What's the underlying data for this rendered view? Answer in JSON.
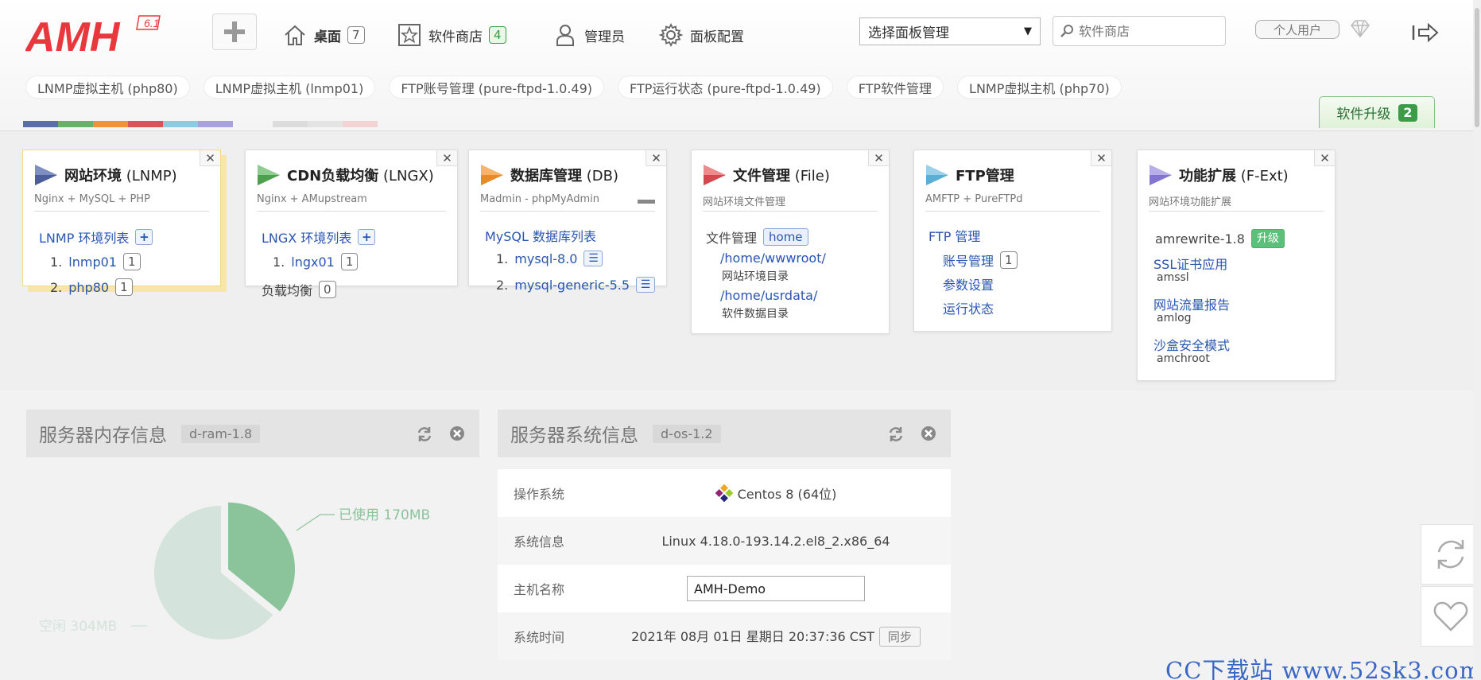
{
  "logo": {
    "text": "AMH",
    "version": "6.1"
  },
  "nav": {
    "desktop": {
      "label": "桌面",
      "count": "7"
    },
    "store": {
      "label": "软件商店",
      "count": "4"
    },
    "admin": {
      "label": "管理员"
    },
    "config": {
      "label": "面板配置"
    }
  },
  "panel_select": {
    "value": "选择面板管理"
  },
  "search": {
    "placeholder": "软件商店"
  },
  "user_button": "个人用户",
  "quick_tabs": [
    "LNMP虚拟主机 (php80)",
    "LNMP虚拟主机 (lnmp01)",
    "FTP账号管理 (pure-ftpd-1.0.49)",
    "FTP运行状态 (pure-ftpd-1.0.49)",
    "FTP软件管理",
    "LNMP虚拟主机 (php70)"
  ],
  "upgrade": {
    "label": "软件升级",
    "count": "2"
  },
  "colors": {
    "accent_green": "#3c9b47",
    "link_blue": "#2a56b0",
    "pie_used": "#8bc49b",
    "pie_free": "#d4e3dc"
  },
  "modules": {
    "lnmp": {
      "title_bold": "网站环境",
      "title_rest": " (LNMP)",
      "sub": "Nginx + MySQL + PHP",
      "list_label": "LNMP 环境列表",
      "items": [
        {
          "n": "1.",
          "name": "lnmp01",
          "count": "1"
        },
        {
          "n": "2.",
          "name": "php80",
          "count": "1"
        }
      ]
    },
    "lngx": {
      "title_bold": "CDN负载均衡",
      "title_rest": " (LNGX)",
      "sub": "Nginx + AMupstream",
      "list_label": "LNGX 环境列表",
      "items": [
        {
          "n": "1.",
          "name": "lngx01",
          "count": "1"
        }
      ],
      "balance_label": "负载均衡",
      "balance_count": "0"
    },
    "db": {
      "title_bold": "数据库管理",
      "title_rest": " (DB)",
      "sub": "Madmin - phpMyAdmin",
      "list_label": "MySQL 数据库列表",
      "items": [
        {
          "n": "1.",
          "name": "mysql-8.0"
        },
        {
          "n": "2.",
          "name": "mysql-generic-5.5"
        }
      ]
    },
    "file": {
      "title_bold": "文件管理",
      "title_rest": " (File)",
      "sub": "网站环境文件管理",
      "label": "文件管理",
      "home": "home",
      "paths": [
        {
          "path": "/home/wwwroot/",
          "desc": "网站环境目录"
        },
        {
          "path": "/home/usrdata/",
          "desc": "软件数据目录"
        }
      ]
    },
    "ftp": {
      "title_bold": "FTP管理",
      "title_rest": "",
      "sub": "AMFTP + PureFTPd",
      "label": "FTP 管理",
      "account": "账号管理",
      "account_count": "1",
      "settings": "参数设置",
      "status": "运行状态"
    },
    "ext": {
      "title_bold": "功能扩展",
      "title_rest": " (F-Ext)",
      "sub": "网站环境功能扩展",
      "item1": "amrewrite-1.8",
      "item1_btn": "升级",
      "items": [
        {
          "name": "SSL证书应用",
          "code": "amssl"
        },
        {
          "name": "网站流量报告",
          "code": "amlog"
        },
        {
          "name": "沙盒安全模式",
          "code": "amchroot"
        }
      ]
    }
  },
  "memory": {
    "title": "服务器内存信息",
    "tag": "d-ram-1.8",
    "used_label": "已使用 170MB",
    "free_label": "空闲 304MB",
    "used_mb": 170,
    "free_mb": 304
  },
  "system": {
    "title": "服务器系统信息",
    "tag": "d-os-1.2",
    "rows": [
      {
        "key": "操作系统",
        "value": "Centos 8 (64位)"
      },
      {
        "key": "系统信息",
        "value": "Linux 4.18.0-193.14.2.el8_2.x86_64"
      },
      {
        "key": "主机名称",
        "value": "AMH-Demo"
      },
      {
        "key": "系统时间",
        "value": "2021年 08月 01日 星期日 20:37:36 CST"
      }
    ],
    "sync_label": "同步"
  },
  "watermark": "CC下载站  www.52sk3.com"
}
